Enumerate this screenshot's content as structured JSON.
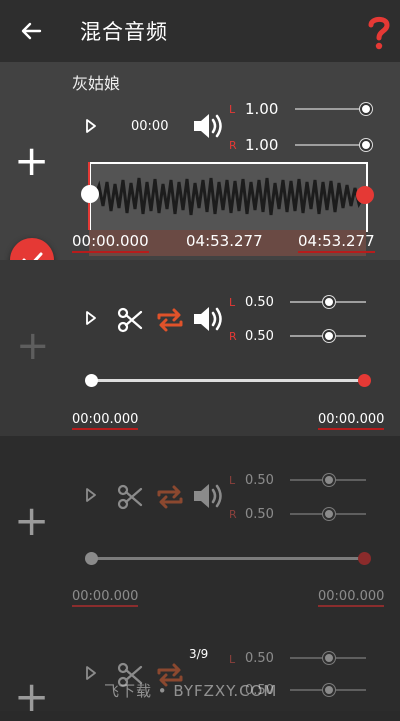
{
  "header": {
    "title": "混合音频",
    "back_icon": "arrow-left-icon",
    "help_icon": "question-mark-icon",
    "help_color": "#e53935"
  },
  "track1": {
    "name": "灰姑娘",
    "position": "00:00",
    "volume_left": "1.00",
    "volume_right": "1.00",
    "start": "00:00.000",
    "duration": "04:53.277",
    "end": "04:53.277"
  },
  "track2": {
    "volume_left": "0.50",
    "volume_right": "0.50",
    "start": "00:00.000",
    "end": "00:00.000"
  },
  "track3": {
    "volume_left": "0.50",
    "volume_right": "0.50",
    "start": "00:00.000",
    "end": "00:00.000"
  },
  "track4": {
    "volume_left": "0.50",
    "volume_right": "0.50",
    "page": "3/9"
  },
  "labels": {
    "l": "L",
    "r": "R"
  },
  "watermark": "飞下载 • BYFZXY.COM",
  "accent": "#e53935",
  "loop_color": "#e0522a"
}
